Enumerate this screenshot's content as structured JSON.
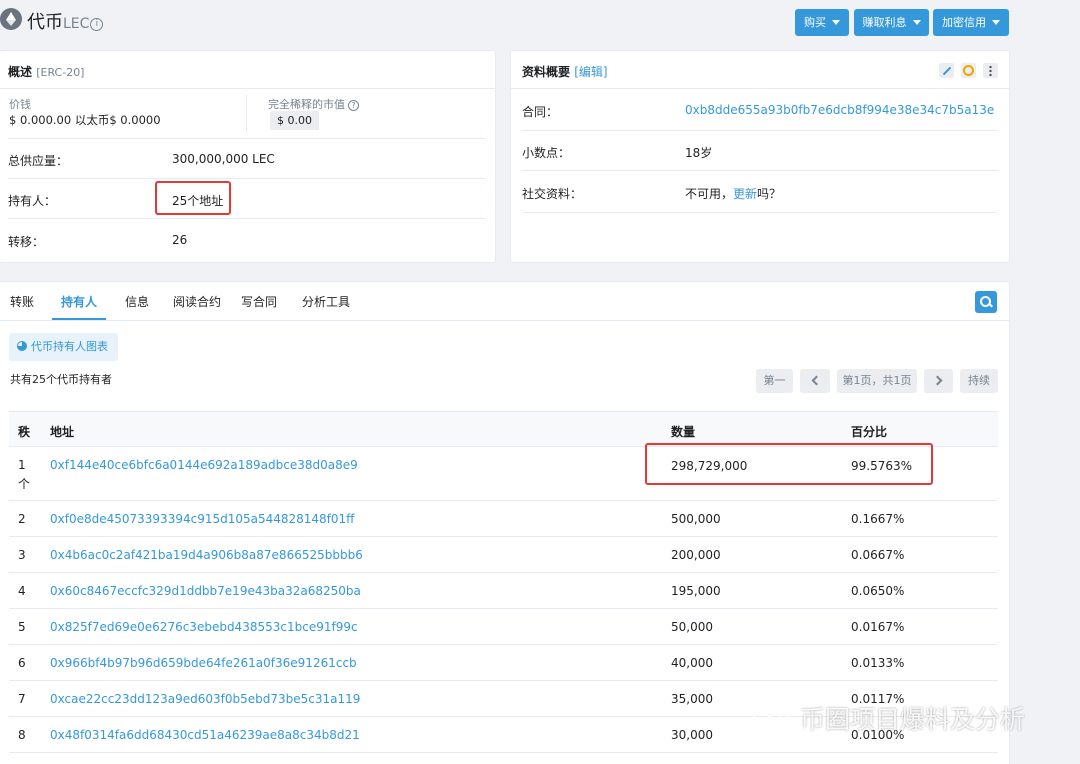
{
  "header": {
    "title": "代币",
    "symbol": "LEC",
    "buttons": [
      {
        "label": "购买"
      },
      {
        "label": "赚取利息"
      },
      {
        "label": "加密信用"
      }
    ]
  },
  "overview": {
    "title": "概述",
    "standard": "[ERC-20]",
    "price_label": "价钱",
    "price_value": "$ 0.000.00 以太币$ 0.0000",
    "mcap_label": "完全稀释的市值",
    "mcap_value": "$ 0.00",
    "rows": [
      {
        "label": "总供应量：",
        "value": "300,000,000 LEC"
      },
      {
        "label": "持有人：",
        "value": "25个地址"
      },
      {
        "label": "转移：",
        "value": "26"
      }
    ]
  },
  "profile": {
    "title": "资料概要",
    "edit": "[编辑]",
    "contract_label": "合同：",
    "contract_value": "0xb8dde655a93b0fb7e6dcb8f994e38e34c7b5a13e",
    "decimals_label": "小数点：",
    "decimals_value": "18岁",
    "social_label": "社交资料：",
    "social_text_a": "不可用，",
    "social_link": "更新",
    "social_text_b": "吗？"
  },
  "tabs": [
    {
      "label": "转账"
    },
    {
      "label": "持有人"
    },
    {
      "label": "信息"
    },
    {
      "label": "阅读合约"
    },
    {
      "label": "写合同"
    },
    {
      "label": "分析工具"
    }
  ],
  "holders": {
    "chart_button": "代币持有人图表",
    "summary": "共有25个代币持有者",
    "pager": {
      "first": "第一",
      "page": "第1页，共1页",
      "last": "持续"
    },
    "columns": {
      "rank": "秩",
      "address": "地址",
      "quantity": "数量",
      "percentage": "百分比"
    },
    "rows": [
      {
        "rank": "1",
        "rank_suffix": "个",
        "address": "0xf144e40ce6bfc6a0144e692a189adbce38d0a8e9",
        "quantity": "298,729,000",
        "percentage": "99.5763%"
      },
      {
        "rank": "2",
        "address": "0xf0e8de45073393394c915d105a544828148f01ff",
        "quantity": "500,000",
        "percentage": "0.1667%"
      },
      {
        "rank": "3",
        "address": "0x4b6ac0c2af421ba19d4a906b8a87e866525bbbb6",
        "quantity": "200,000",
        "percentage": "0.0667%"
      },
      {
        "rank": "4",
        "address": "0x60c8467eccfc329d1ddbb7e19e43ba32a68250ba",
        "quantity": "195,000",
        "percentage": "0.0650%"
      },
      {
        "rank": "5",
        "address": "0x825f7ed69e0e6276c3ebebd438553c1bce91f99c",
        "quantity": "50,000",
        "percentage": "0.0167%"
      },
      {
        "rank": "6",
        "address": "0x966bf4b97b96d659bde64fe261a0f36e91261ccb",
        "quantity": "40,000",
        "percentage": "0.0133%"
      },
      {
        "rank": "7",
        "address": "0xcae22cc23dd123a9ed603f0b5ebd73be5c31a119",
        "quantity": "35,000",
        "percentage": "0.0117%"
      },
      {
        "rank": "8",
        "address": "0x48f0314fa6dd68430cd51a46239ae8a8c34b8d21",
        "quantity": "30,000",
        "percentage": "0.0100%"
      }
    ]
  },
  "watermark": "币圈项目爆料及分析",
  "colors": {
    "accent": "#3498db",
    "highlight": "#e53935"
  }
}
